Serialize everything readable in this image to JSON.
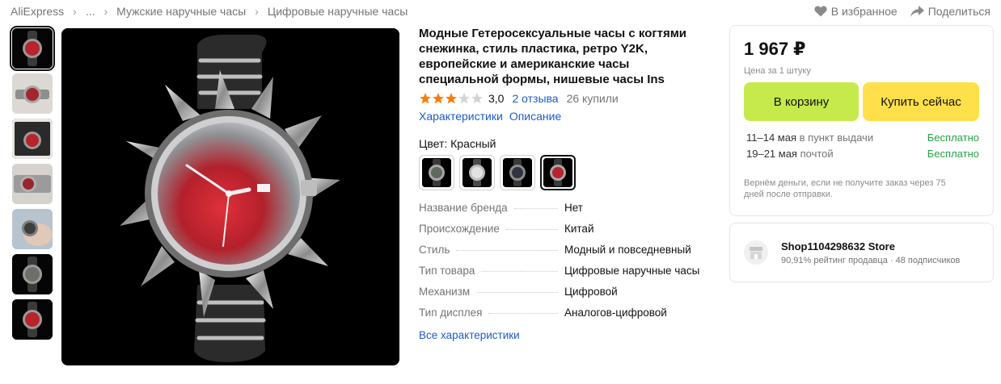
{
  "breadcrumb": {
    "items": [
      "AliExpress",
      "...",
      "Мужские наручные часы",
      "Цифровые наручные часы"
    ]
  },
  "actions": {
    "favorite": "В избранное",
    "share": "Поделиться"
  },
  "product": {
    "title": "Модные Гетеросексуальные часы с когтями снежинка, стиль пластика, ретро Y2K, европейские и американские часы специальной формы, нишевые часы Ins",
    "rating": "3,0",
    "rating_stars_filled": 3,
    "reviews": "2 отзыва",
    "sold": "26 купили",
    "tabs": [
      "Характеристики",
      "Описание"
    ],
    "color_label": "Цвет: Красный",
    "color_options": [
      "silver-green",
      "silver-white",
      "black-blue",
      "red"
    ],
    "selected_color_index": 3,
    "specs": [
      {
        "name": "Название бренда",
        "value": "Нет"
      },
      {
        "name": "Происхождение",
        "value": "Китай"
      },
      {
        "name": "Стиль",
        "value": "Модный и повседневный"
      },
      {
        "name": "Тип товара",
        "value": "Цифровые наручные часы"
      },
      {
        "name": "Механизм",
        "value": "Цифровой"
      },
      {
        "name": "Тип дисплея",
        "value": "Аналогов-цифровой"
      }
    ],
    "all_specs_link": "Все характеристики",
    "thumbnails": [
      "dark",
      "light",
      "dark",
      "light",
      "light",
      "dark",
      "dark"
    ],
    "selected_thumbnail": 0
  },
  "buybox": {
    "price": "1 967 ₽",
    "price_note": "Цена за 1 штуку",
    "cart_button": "В корзину",
    "buy_button": "Купить сейчас",
    "delivery": [
      {
        "dates": "11–14 мая",
        "via": "в пункт выдачи",
        "cost": "Бесплатно"
      },
      {
        "dates": "19–21 мая",
        "via": "почтой",
        "cost": "Бесплатно"
      }
    ],
    "refund_note": "Вернём деньги, если не получите заказ через 75 дней после отправки."
  },
  "store": {
    "name": "Shop1104298632 Store",
    "meta": "90,91% рейтинг продавца · 48 подписчиков"
  },
  "colors": {
    "link": "#1f5bc6",
    "cart_button": "#c6ea4b",
    "buy_button": "#ffe04a",
    "free_delivery": "#25a244",
    "star_filled": "#ff7a00",
    "star_empty": "#d4d4d4",
    "watch_dial": "#c0202a"
  }
}
